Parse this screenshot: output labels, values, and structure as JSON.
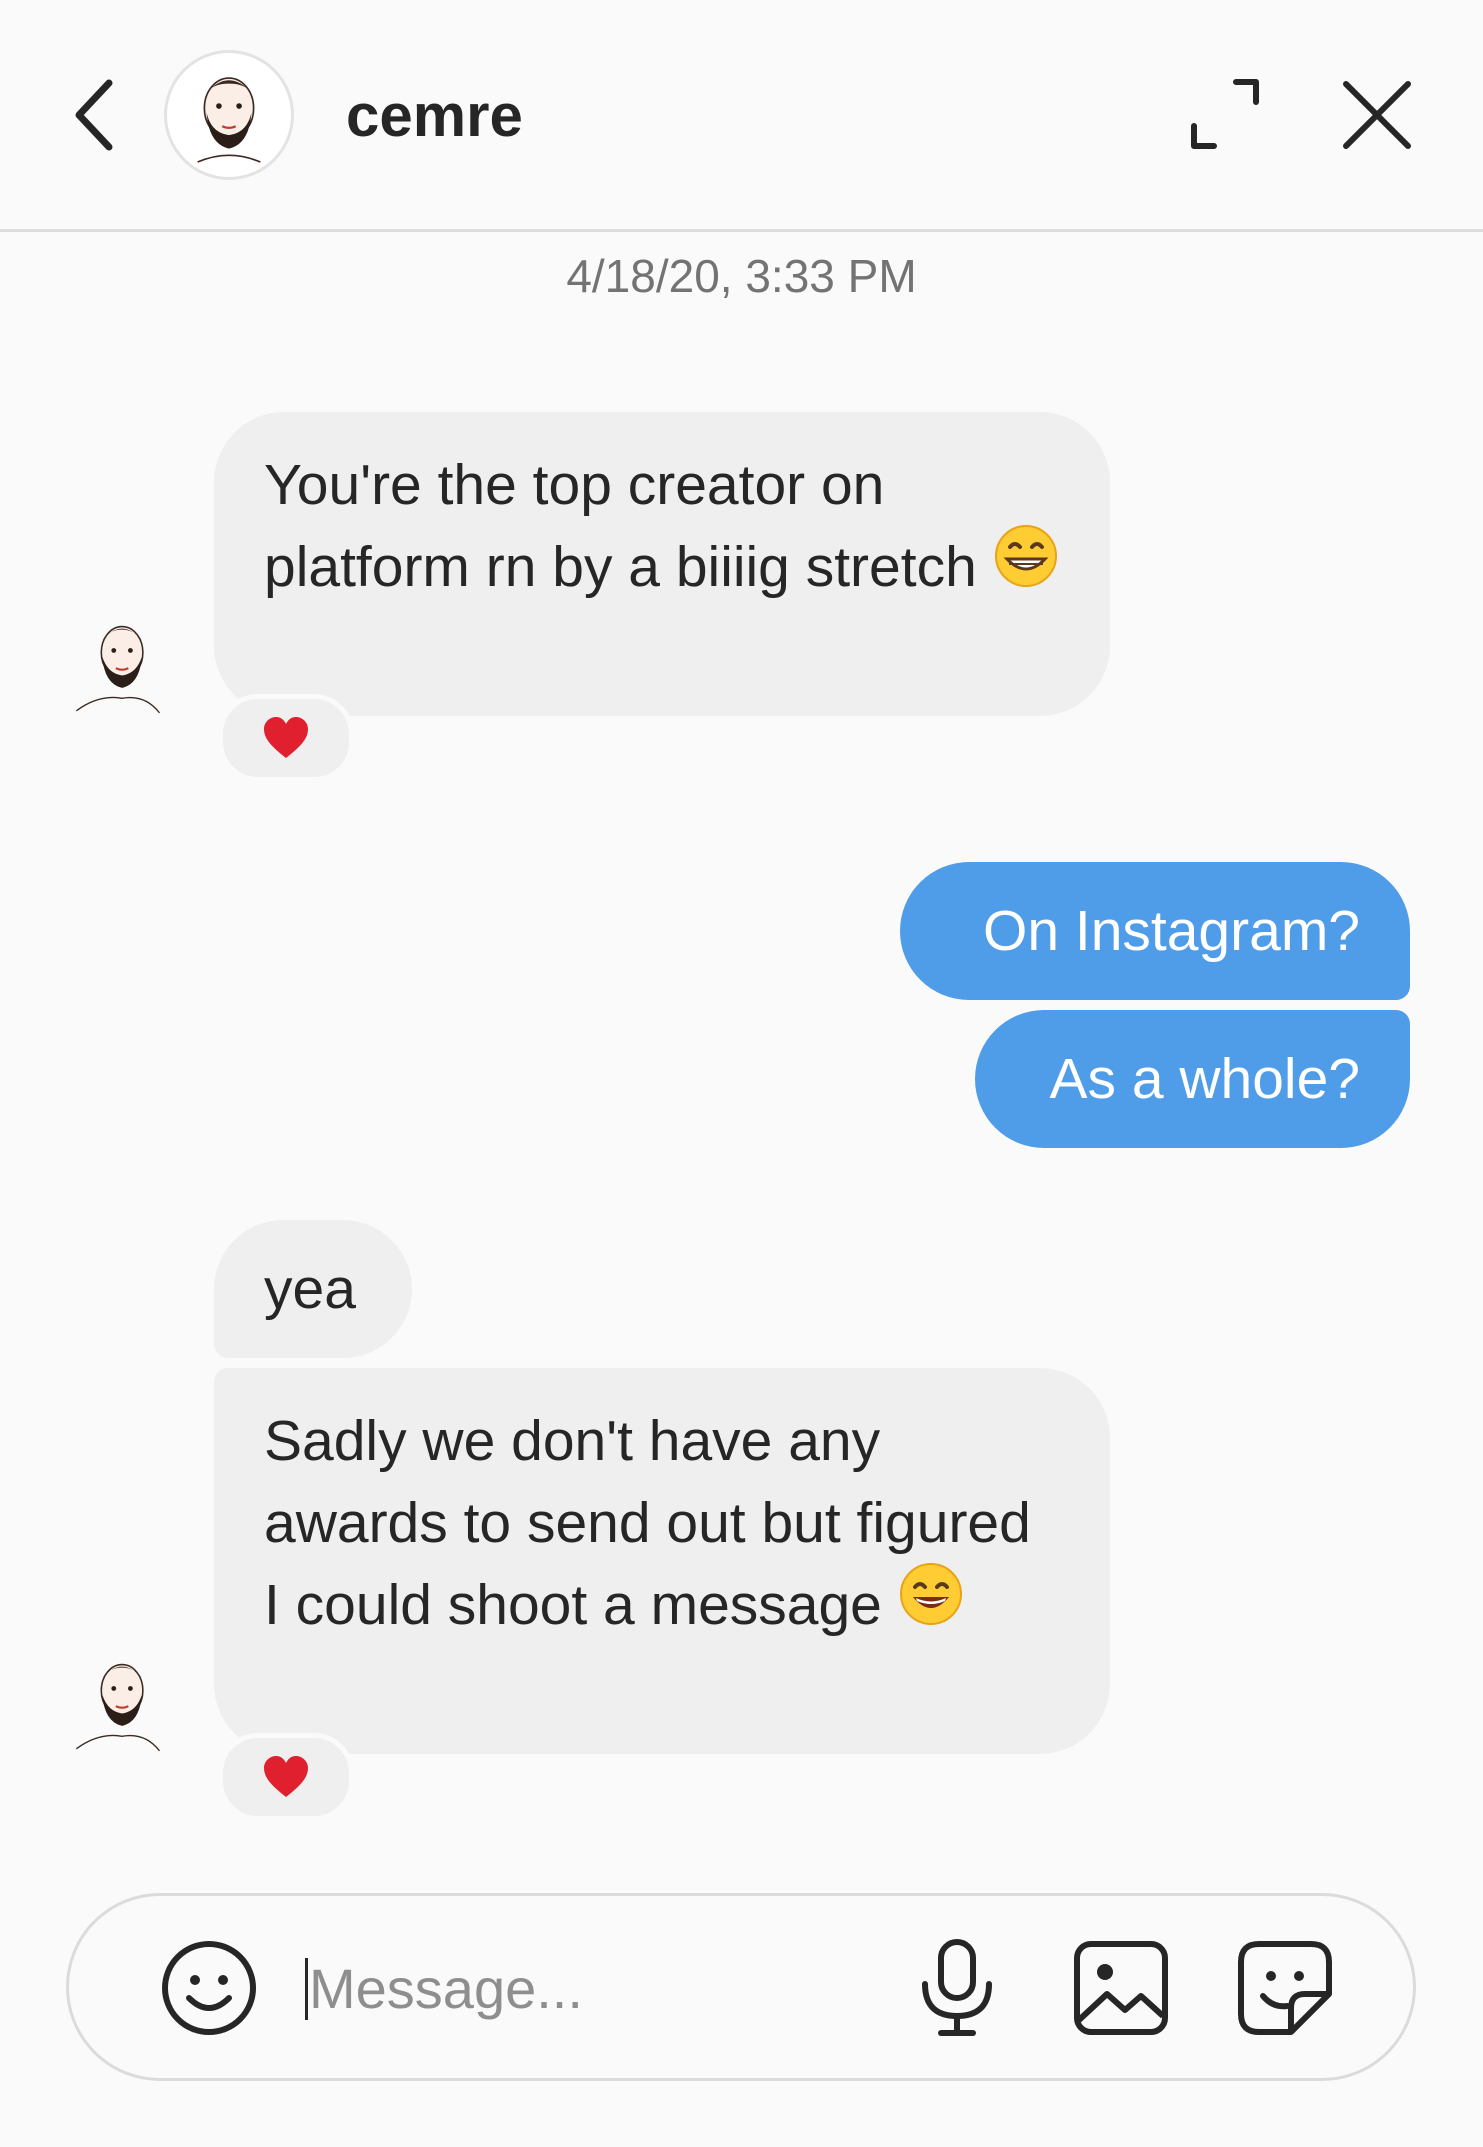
{
  "header": {
    "username": "cemre",
    "icons": {
      "back": "chevron-left-icon",
      "expand": "expand-icon",
      "close": "close-icon"
    }
  },
  "conversation": {
    "timestamp": "4/18/20, 3:33 PM",
    "messages": [
      {
        "direction": "incoming",
        "text": "You're the top creator on platform rn by a biiiig stretch",
        "emoji": "😁",
        "reaction": "❤️"
      },
      {
        "direction": "outgoing",
        "text": "On Instagram?"
      },
      {
        "direction": "outgoing",
        "text": "As a whole?"
      },
      {
        "direction": "incoming",
        "text": "yea"
      },
      {
        "direction": "incoming",
        "text": "Sadly we don't have any awards to send out but figured I could shoot a message",
        "emoji": "😄",
        "reaction": "❤️"
      }
    ]
  },
  "composer": {
    "placeholder": "Message...",
    "value": "",
    "icons": {
      "emoji": "smiley-icon",
      "voice": "microphone-icon",
      "gallery": "image-icon",
      "sticker": "sticker-icon"
    }
  },
  "colors": {
    "background": "#fafafa",
    "incoming_bubble": "#efefef",
    "outgoing_bubble": "#4f9de9",
    "text": "#262626",
    "muted": "#737373",
    "heart": "#e0202f"
  }
}
